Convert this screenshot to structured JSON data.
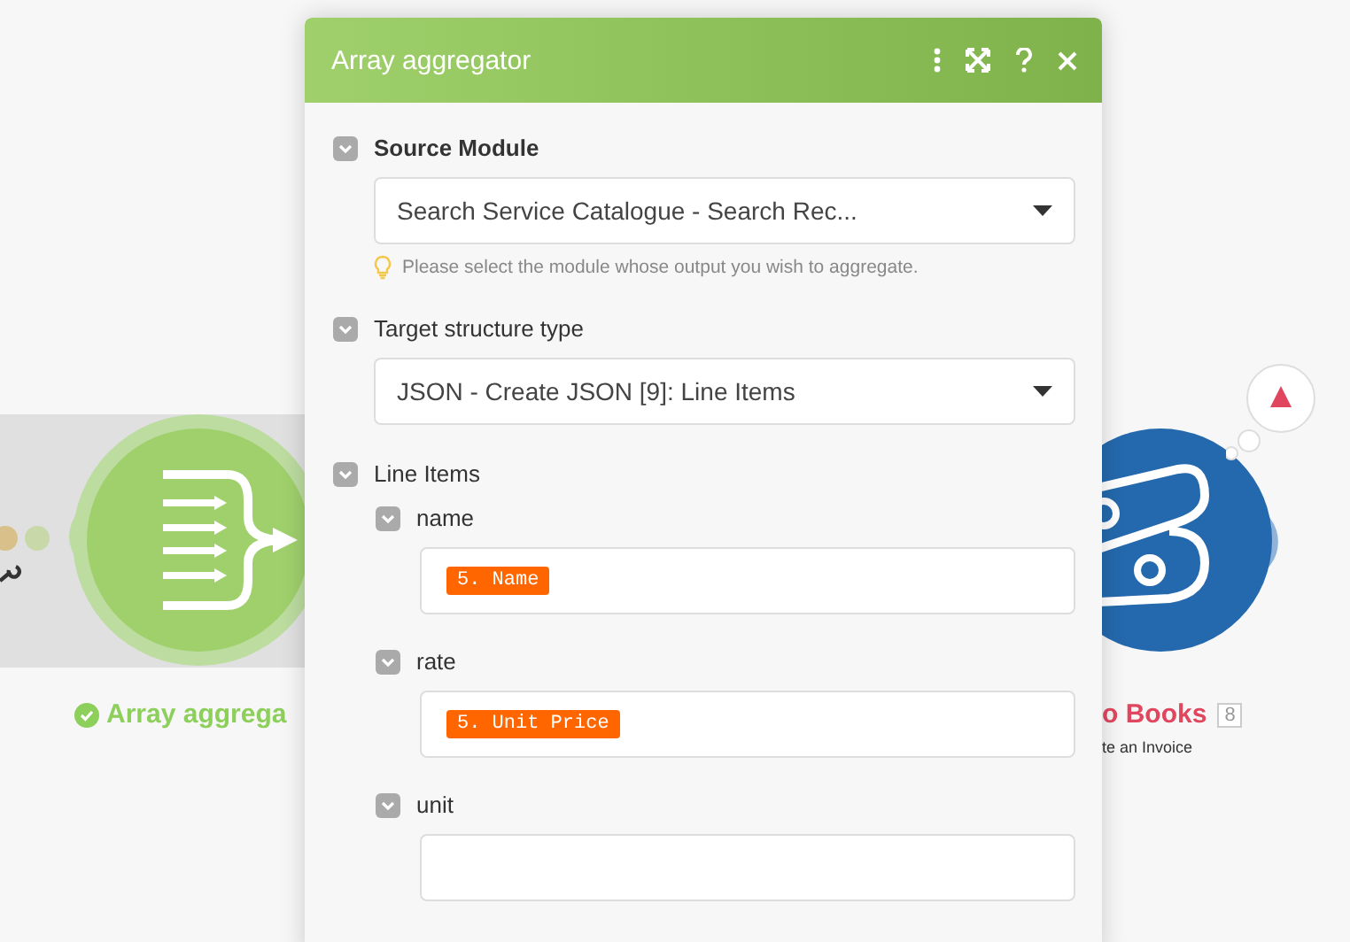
{
  "canvas": {
    "left_module": {
      "label": "Array aggrega",
      "ok": true
    },
    "right_module": {
      "label": "o Books",
      "badge": "8",
      "subtitle": "te an Invoice",
      "warning": true
    }
  },
  "dialog": {
    "title": "Array aggregator",
    "fields": [
      {
        "kind": "select",
        "label": "Source Module",
        "required": true,
        "value": "Search Service Catalogue - Search Rec...",
        "hint": "Please select the module whose output you wish to aggregate."
      },
      {
        "kind": "select",
        "label": "Target structure type",
        "required": false,
        "value": "JSON - Create JSON [9]: Line Items"
      },
      {
        "kind": "group",
        "label": "Line Items",
        "required": false,
        "children": [
          {
            "label": "name",
            "token": "5. Name"
          },
          {
            "label": "rate",
            "token": "5. Unit Price"
          },
          {
            "label": "unit"
          }
        ]
      }
    ]
  }
}
